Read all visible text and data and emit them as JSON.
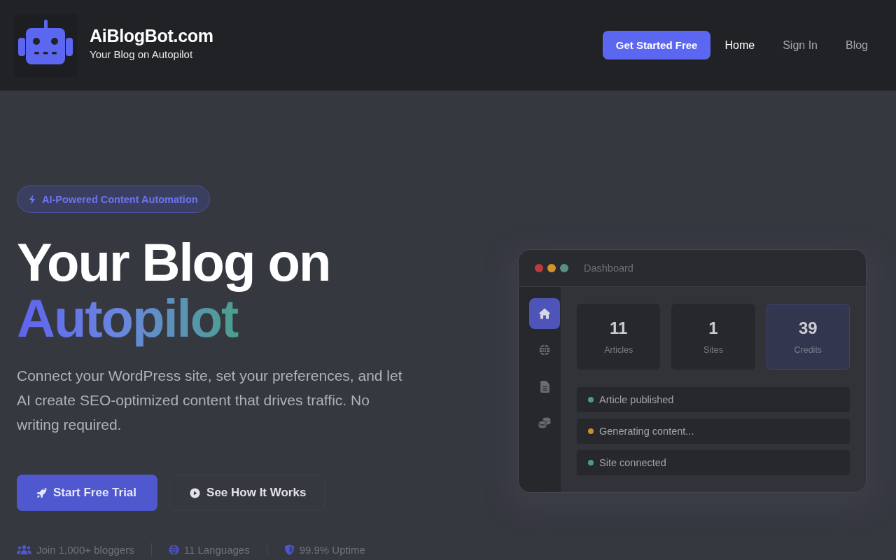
{
  "header": {
    "logo": {
      "title": "AiBlogBot.com",
      "tagline": "Your Blog on Autopilot"
    },
    "cta": "Get Started Free",
    "nav": [
      {
        "label": "Home",
        "selected": true
      },
      {
        "label": "Sign In",
        "selected": false
      },
      {
        "label": "Blog",
        "selected": false
      }
    ]
  },
  "hero": {
    "badge": "AI-Powered Content Automation",
    "title": "Your Blog on",
    "title_highlight": "Autopilot",
    "description": "Connect your WordPress site, set your preferences, and let AI create SEO-optimized content that drives traffic. No writing required.",
    "buttons": [
      {
        "label": "Start Free Trial",
        "kind": "primary"
      },
      {
        "label": "See How It Works",
        "kind": "secondary"
      }
    ],
    "stats": [
      {
        "label": "Join 1,000+ bloggers"
      },
      {
        "label": "11 Languages"
      },
      {
        "label": "99.9% Uptime"
      }
    ]
  },
  "dashboard": {
    "title": "Dashboard",
    "sidebar": [
      {
        "selected": true
      },
      {
        "selected": false
      },
      {
        "selected": false
      },
      {
        "selected": false
      }
    ],
    "stats": [
      {
        "value": "11",
        "label": "Articles",
        "highlighted": false
      },
      {
        "value": "1",
        "label": "Sites",
        "highlighted": false
      },
      {
        "value": "39",
        "label": "Credits",
        "highlighted": true
      }
    ],
    "activity": [
      {
        "text": "Article published",
        "color": "#4e9a86"
      },
      {
        "text": "Generating content...",
        "color": "#c8902a"
      },
      {
        "text": "Site connected",
        "color": "#4e9a86"
      }
    ]
  }
}
